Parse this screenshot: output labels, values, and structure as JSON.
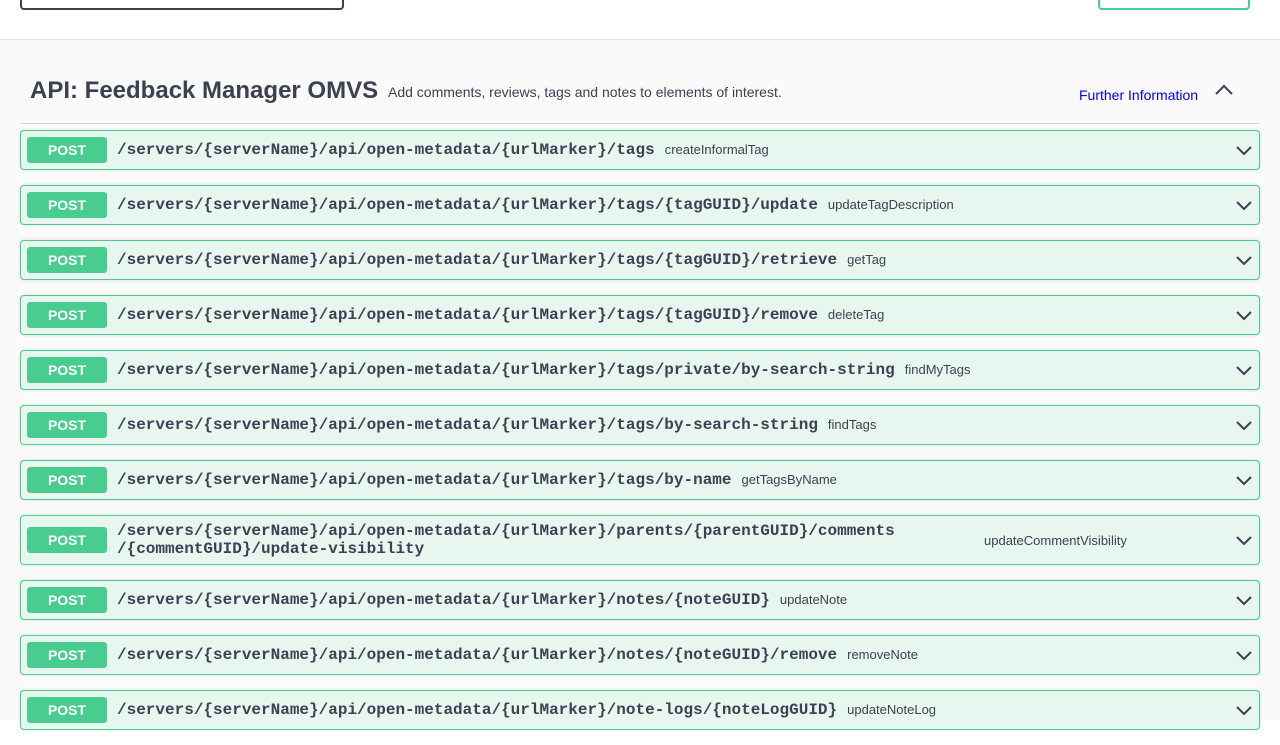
{
  "section": {
    "title": "API: Feedback Manager OMVS",
    "description": "Add comments, reviews, tags and notes to elements of interest.",
    "further_link": "Further Information"
  },
  "colors": {
    "post": "#49cc90",
    "post_bg": "#e8f6f0",
    "text": "#3b4151",
    "link": "#0000ee"
  },
  "operations": [
    {
      "method": "POST",
      "path": "/servers/{serverName}/api/open-metadata/{urlMarker}/tags",
      "summary": "createInformalTag"
    },
    {
      "method": "POST",
      "path": "/servers/{serverName}/api/open-metadata/{urlMarker}/tags/{tagGUID}/update",
      "summary": "updateTagDescription"
    },
    {
      "method": "POST",
      "path": "/servers/{serverName}/api/open-metadata/{urlMarker}/tags/{tagGUID}/retrieve",
      "summary": "getTag"
    },
    {
      "method": "POST",
      "path": "/servers/{serverName}/api/open-metadata/{urlMarker}/tags/{tagGUID}/remove",
      "summary": "deleteTag"
    },
    {
      "method": "POST",
      "path": "/servers/{serverName}/api/open-metadata/{urlMarker}/tags/private/by-search-string",
      "summary": "findMyTags"
    },
    {
      "method": "POST",
      "path": "/servers/{serverName}/api/open-metadata/{urlMarker}/tags/by-search-string",
      "summary": "findTags"
    },
    {
      "method": "POST",
      "path": "/servers/{serverName}/api/open-metadata/{urlMarker}/tags/by-name",
      "summary": "getTagsByName"
    },
    {
      "method": "POST",
      "path_line1": "/servers/{serverName}/api/open-metadata/{urlMarker}/parents/{parentGUID}/comments",
      "path_line2": "/{commentGUID}/update-visibility",
      "summary": "updateCommentVisibility"
    },
    {
      "method": "POST",
      "path": "/servers/{serverName}/api/open-metadata/{urlMarker}/notes/{noteGUID}",
      "summary": "updateNote"
    },
    {
      "method": "POST",
      "path": "/servers/{serverName}/api/open-metadata/{urlMarker}/notes/{noteGUID}/remove",
      "summary": "removeNote"
    },
    {
      "method": "POST",
      "path": "/servers/{serverName}/api/open-metadata/{urlMarker}/note-logs/{noteLogGUID}",
      "summary": "updateNoteLog"
    }
  ]
}
